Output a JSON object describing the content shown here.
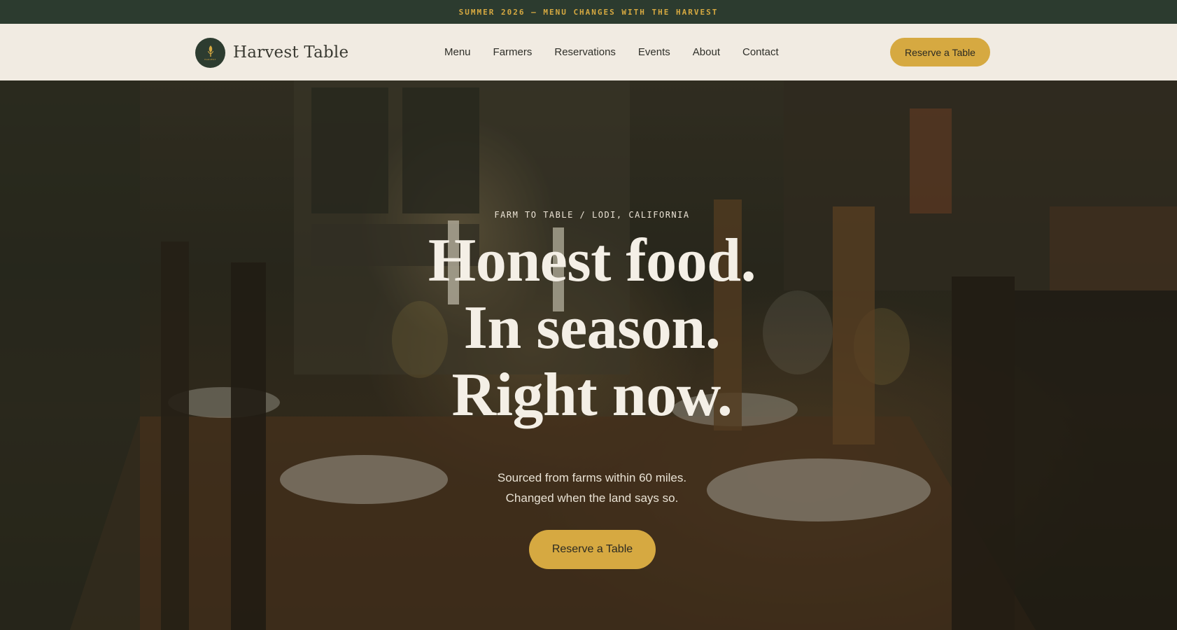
{
  "announcement": "SUMMER 2026 — MENU CHANGES WITH THE HARVEST",
  "brand": {
    "name": "Harvest Table",
    "logo_icon": "wheat-icon",
    "logo_small_text": "HARVEST"
  },
  "nav": {
    "links": [
      "Menu",
      "Farmers",
      "Reservations",
      "Events",
      "About",
      "Contact"
    ],
    "cta_label": "Reserve a Table"
  },
  "hero": {
    "eyebrow": "FARM TO TABLE / LODI, CALIFORNIA",
    "headline": [
      "Honest food.",
      "In season.",
      "Right now."
    ],
    "subcopy": [
      "Sourced from farms within 60 miles.",
      "Changed when the land says so."
    ],
    "cta_label": "Reserve a Table",
    "background": "candlelit-dining-table-photo"
  },
  "colors": {
    "announcement_bg": "#2c3b2f",
    "accent_gold": "#d6a941",
    "nav_bg": "#f1ebe2",
    "hero_text": "#f4efe6"
  }
}
